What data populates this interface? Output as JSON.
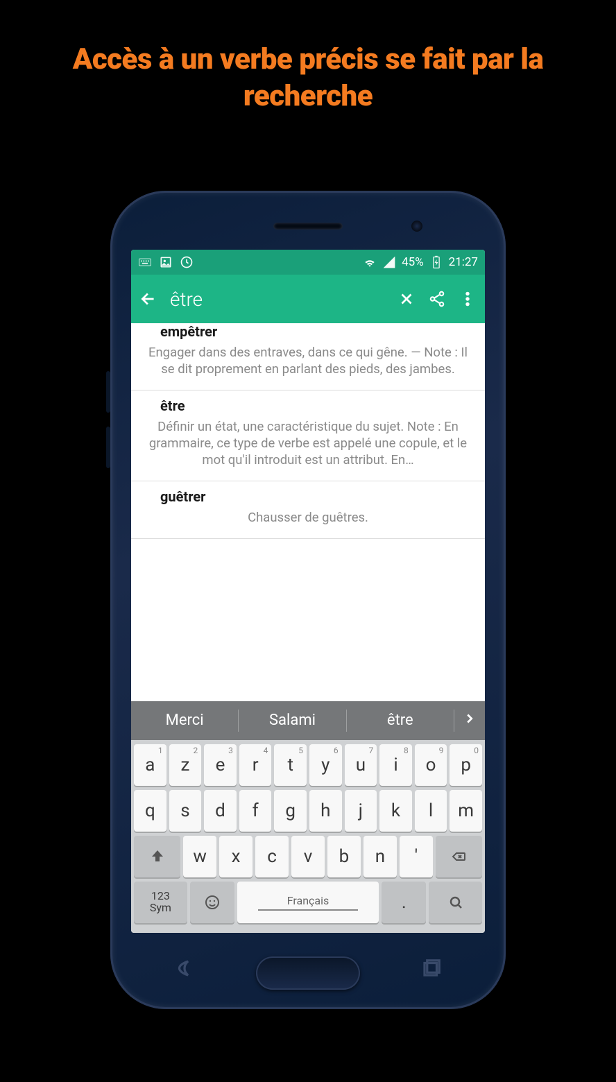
{
  "headline": "Accès à un verbe précis se fait par la recherche",
  "statusbar": {
    "battery": "45%",
    "time": "21:27"
  },
  "appbar": {
    "search_value": "être"
  },
  "results": [
    {
      "word": "empêtrer",
      "definition": "Engager dans des entraves, dans ce qui gêne. — Note : Il se dit proprement en parlant des pieds, des jambes."
    },
    {
      "word": "être",
      "definition": "Définir un état, une caractéristique du sujet. Note : En grammaire, ce type de verbe est appelé une copule, et le mot qu'il introduit est un attribut. En…"
    },
    {
      "word": "guêtrer",
      "definition": "Chausser de guêtres."
    }
  ],
  "keyboard": {
    "suggestions": [
      "Merci",
      "Salami",
      "être"
    ],
    "row1": [
      {
        "k": "a",
        "s": "1"
      },
      {
        "k": "z",
        "s": "2"
      },
      {
        "k": "e",
        "s": "3"
      },
      {
        "k": "r",
        "s": "4"
      },
      {
        "k": "t",
        "s": "5"
      },
      {
        "k": "y",
        "s": "6"
      },
      {
        "k": "u",
        "s": "7"
      },
      {
        "k": "i",
        "s": "8"
      },
      {
        "k": "o",
        "s": "9"
      },
      {
        "k": "p",
        "s": "0"
      }
    ],
    "row2": [
      "q",
      "s",
      "d",
      "f",
      "g",
      "h",
      "j",
      "k",
      "l",
      "m"
    ],
    "row3": [
      "w",
      "x",
      "c",
      "v",
      "b",
      "n"
    ],
    "apostrophe": "'",
    "sym_label": "123\nSym",
    "space_label": "Français",
    "period": "."
  }
}
